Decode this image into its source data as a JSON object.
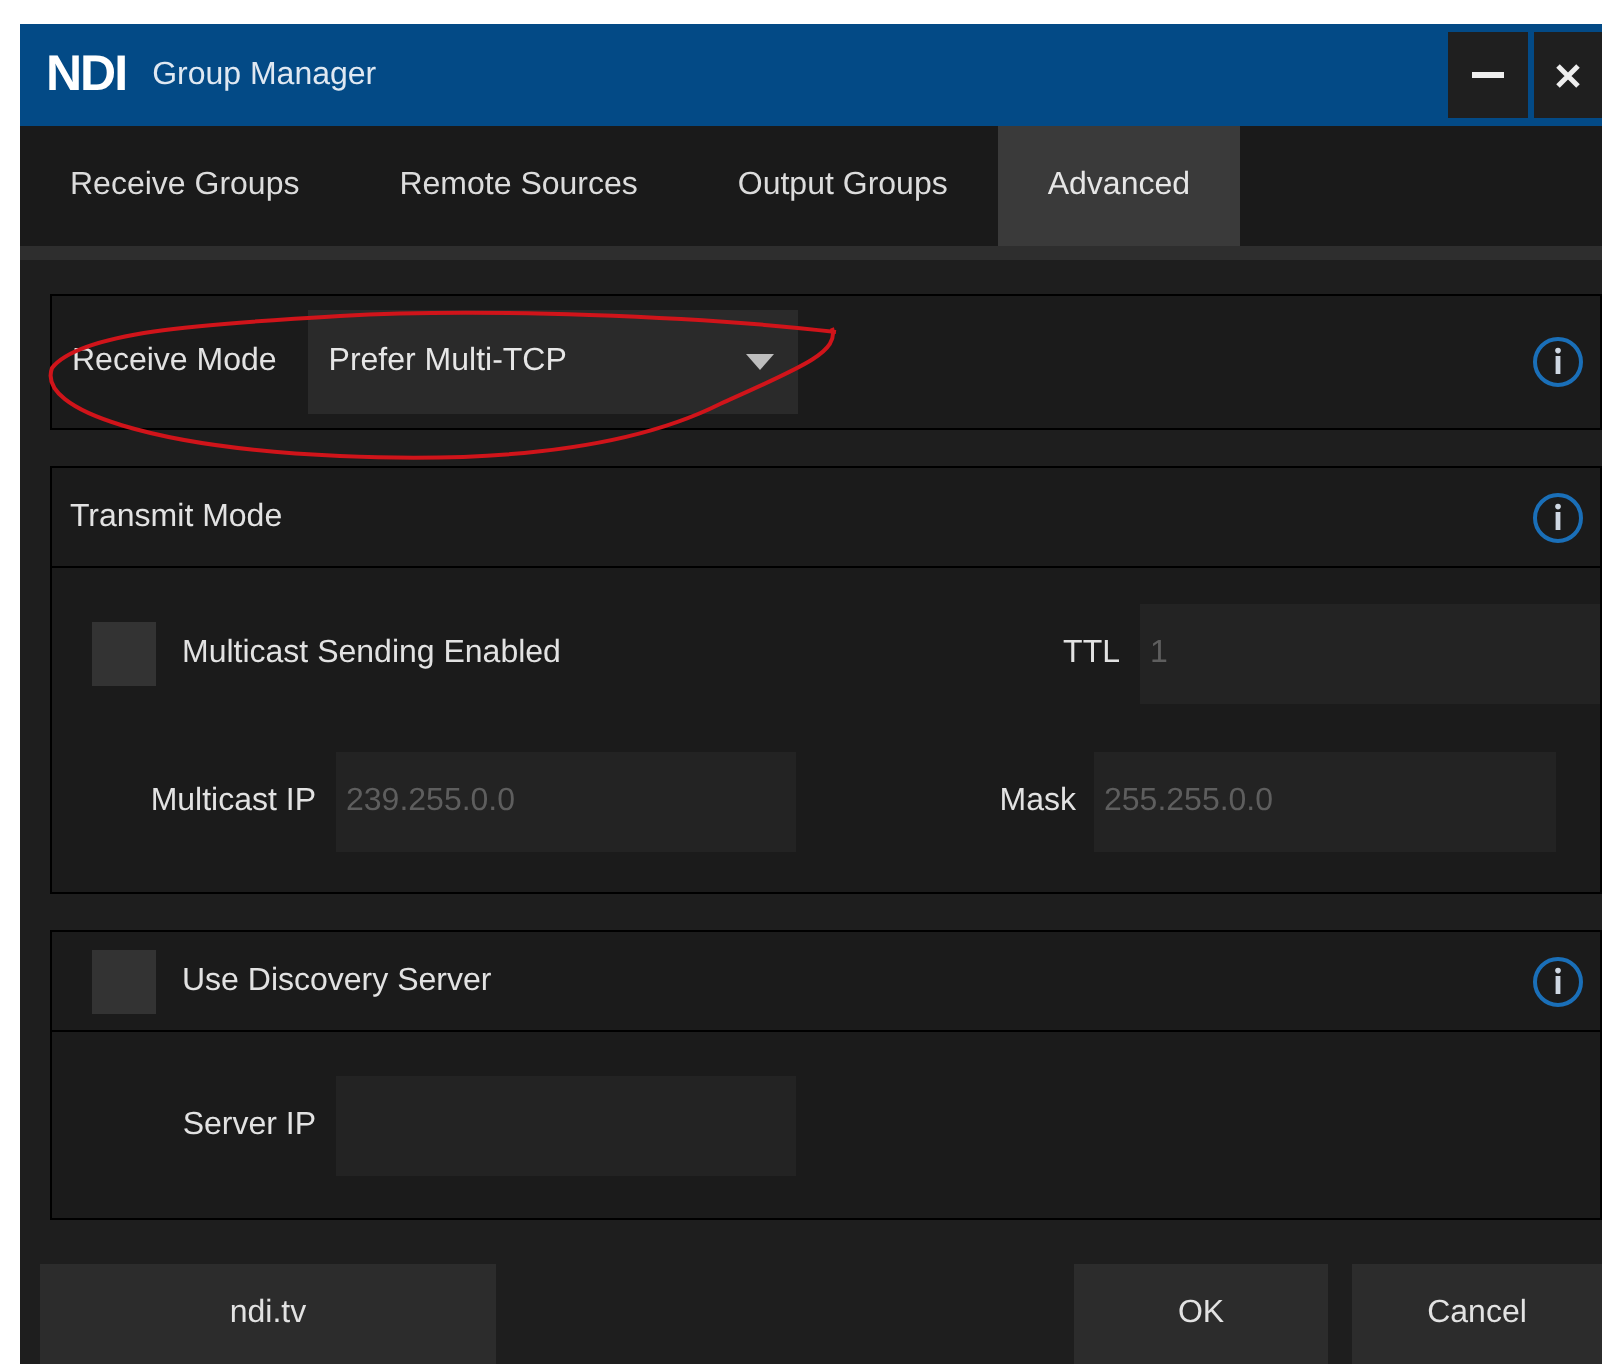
{
  "window": {
    "logo": "NDI",
    "title": "Group Manager"
  },
  "tabs": [
    {
      "label": "Receive Groups",
      "selected": false
    },
    {
      "label": "Remote Sources",
      "selected": false
    },
    {
      "label": "Output Groups",
      "selected": false
    },
    {
      "label": "Advanced",
      "selected": true
    }
  ],
  "receive_mode": {
    "label": "Receive Mode",
    "value": "Prefer Multi-TCP"
  },
  "transmit_mode": {
    "title": "Transmit Mode",
    "multicast": {
      "label": "Multicast Sending Enabled",
      "checked": false
    },
    "ttl": {
      "label": "TTL",
      "value": "1",
      "disabled": true
    },
    "multicast_ip": {
      "label": "Multicast IP",
      "value": "239.255.0.0",
      "disabled": true
    },
    "mask": {
      "label": "Mask",
      "value": "255.255.0.0",
      "disabled": true
    }
  },
  "discovery": {
    "label": "Use Discovery Server",
    "checked": false,
    "server_ip": {
      "label": "Server IP"
    }
  },
  "buttons": [
    {
      "label": "ndi.tv"
    },
    {
      "label": "OK"
    },
    {
      "label": "Cancel"
    }
  ]
}
